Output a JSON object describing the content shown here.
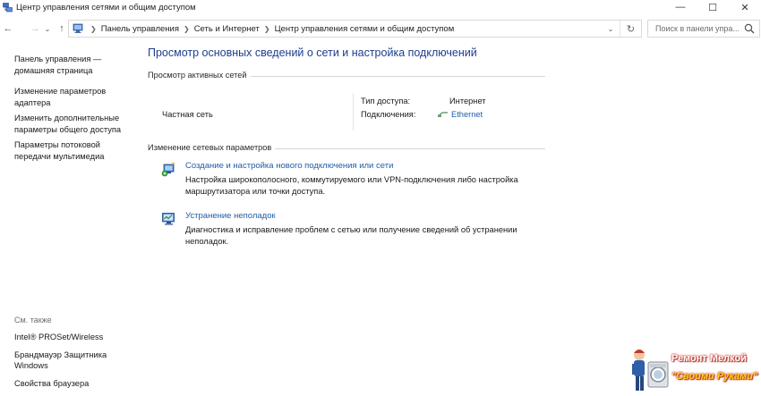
{
  "window": {
    "title": "Центр управления сетями и общим доступом",
    "icon": "network-center-icon",
    "controls": {
      "minimize": "—",
      "maximize": "☐",
      "close": "✕"
    }
  },
  "nav": {
    "back": "←",
    "forward": "→",
    "recent": "⌄",
    "up": "↑"
  },
  "address": {
    "breadcrumbs": [
      "Панель управления",
      "Сеть и Интернет",
      "Центр управления сетями и общим доступом"
    ],
    "dropdown": "⌄",
    "refresh": "↻"
  },
  "search": {
    "placeholder": "Поиск в панели упра..."
  },
  "left_pane": {
    "home": "Панель управления — домашняя страница",
    "links": [
      "Изменение параметров адаптера",
      "Изменить дополнительные параметры общего доступа",
      "Параметры потоковой передачи мультимедиа"
    ],
    "see_also_title": "См. также",
    "see_also": [
      "Intel® PROSet/Wireless",
      "Брандмауэр Защитника Windows",
      "Свойства браузера"
    ]
  },
  "main": {
    "title": "Просмотр основных сведений о сети и настройка подключений",
    "active_networks_label": "Просмотр активных сетей",
    "network": {
      "name": "Частная сеть",
      "access_type_label": "Тип доступа:",
      "access_type_value": "Интернет",
      "connections_label": "Подключения:",
      "connections_value": "Ethernet"
    },
    "change_settings_label": "Изменение сетевых параметров",
    "tasks": [
      {
        "icon": "new-connection-icon",
        "link": "Создание и настройка нового подключения или сети",
        "desc": "Настройка широкополосного, коммутируемого или VPN-подключения либо настройка маршрутизатора или точки доступа."
      },
      {
        "icon": "troubleshoot-icon",
        "link": "Устранение неполадок",
        "desc": "Диагностика и исправление проблем с сетью или получение сведений об устранении неполадок."
      }
    ]
  },
  "watermark": {
    "line1": "Ремонт Мелкой",
    "line2": "\"Своими Руками\""
  },
  "colors": {
    "link": "#1f5ea8",
    "title": "#1e3d8c",
    "rule": "#d6d6d6"
  }
}
